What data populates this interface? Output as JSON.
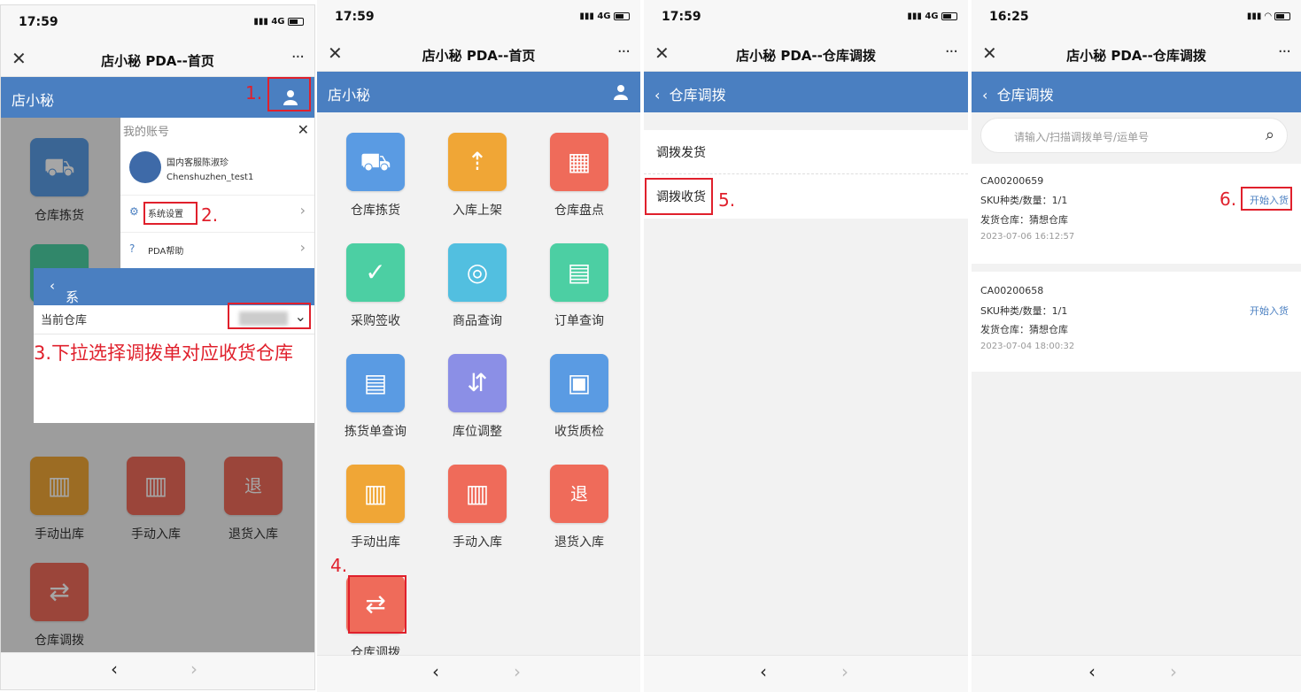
{
  "panels": [
    {
      "time": "17:59",
      "signal": "4G",
      "title": "店小秘 PDA--首页",
      "header_label": "店小秘",
      "tiles": [
        {
          "name": "仓库拣货",
          "color": "#5a9be3",
          "icon": "trolley-icon",
          "glyph": "⛟"
        },
        {
          "name": "手动出库",
          "color": "#f0a636",
          "icon": "scanner-out-icon",
          "glyph": "▥"
        },
        {
          "name": "手动入库",
          "color": "#ef6b5a",
          "icon": "scanner-in-icon",
          "glyph": "▥"
        },
        {
          "name": "退货入库",
          "color": "#ef6b5a",
          "icon": "return-icon",
          "glyph": "退"
        },
        {
          "name": "仓库调拨",
          "color": "#ef6b5a",
          "icon": "transfer-icon",
          "glyph": "⇄"
        }
      ],
      "account_menu": {
        "header": "我的账号",
        "user_name": "国内客服陈淑珍",
        "user_id": "Chenshuzhen_test1",
        "items": [
          "系统设置",
          "PDA帮助"
        ]
      },
      "settings": {
        "title": "系统设置",
        "current_warehouse_label": "当前仓库"
      },
      "annotations": [
        "1.",
        "2.",
        "3.下拉选择调拨单对应收货仓库"
      ]
    },
    {
      "time": "17:59",
      "signal": "4G",
      "title": "店小秘 PDA--首页",
      "header_label": "店小秘",
      "tiles": [
        {
          "name": "仓库拣货",
          "color": "#5a9be3",
          "icon": "trolley-icon",
          "glyph": "⛟"
        },
        {
          "name": "入库上架",
          "color": "#f0a636",
          "icon": "shelf-up-icon",
          "glyph": "⇡"
        },
        {
          "name": "仓库盘点",
          "color": "#ef6b5a",
          "icon": "calculator-icon",
          "glyph": "▦"
        },
        {
          "name": "采购签收",
          "color": "#4ccfa3",
          "icon": "sign-box-icon",
          "glyph": "✓"
        },
        {
          "name": "商品查询",
          "color": "#52bfe0",
          "icon": "magnifier-icon",
          "glyph": "◎"
        },
        {
          "name": "订单查询",
          "color": "#4ccfa3",
          "icon": "order-doc-icon",
          "glyph": "▤"
        },
        {
          "name": "拣货单查询",
          "color": "#5a9be3",
          "icon": "pick-list-icon",
          "glyph": "▤"
        },
        {
          "name": "库位调整",
          "color": "#8b8fe6",
          "icon": "location-adjust-icon",
          "glyph": "⇵"
        },
        {
          "name": "收货质检",
          "color": "#5a9be3",
          "icon": "inspection-icon",
          "glyph": "▣"
        },
        {
          "name": "手动出库",
          "color": "#f0a636",
          "icon": "scanner-out-icon",
          "glyph": "▥"
        },
        {
          "name": "手动入库",
          "color": "#ef6b5a",
          "icon": "scanner-in-icon",
          "glyph": "▥"
        },
        {
          "name": "退货入库",
          "color": "#ef6b5a",
          "icon": "return-icon",
          "glyph": "退"
        },
        {
          "name": "仓库调拨",
          "color": "#ef6b5a",
          "icon": "transfer-icon",
          "glyph": "⇄"
        }
      ],
      "annotations": [
        "4."
      ]
    },
    {
      "time": "17:59",
      "signal": "4G",
      "title": "店小秘 PDA--仓库调拨",
      "header_label": "仓库调拨",
      "items": [
        "调拨发货",
        "调拨收货"
      ],
      "annotations": [
        "5."
      ]
    },
    {
      "time": "16:25",
      "signal": "wifi",
      "title": "店小秘 PDA--仓库调拨",
      "header_label": "仓库调拨",
      "search_placeholder": "请输入/扫描调拨单号/运单号",
      "cards": [
        {
          "order_no": "CA00200659",
          "sku": "SKU种类/数量：1/1",
          "warehouse": "发货仓库：猜想仓库",
          "date": "2023-07-06 16:12:57",
          "action": "开始入货"
        },
        {
          "order_no": "CA00200658",
          "sku": "SKU种类/数量：1/1",
          "warehouse": "发货仓库：猜想仓库",
          "date": "2023-07-04 18:00:32",
          "action": "开始入货"
        }
      ],
      "annotations": [
        "6."
      ]
    }
  ],
  "accent_color": "#4a7fc1",
  "annotation_color": "#e0202c"
}
